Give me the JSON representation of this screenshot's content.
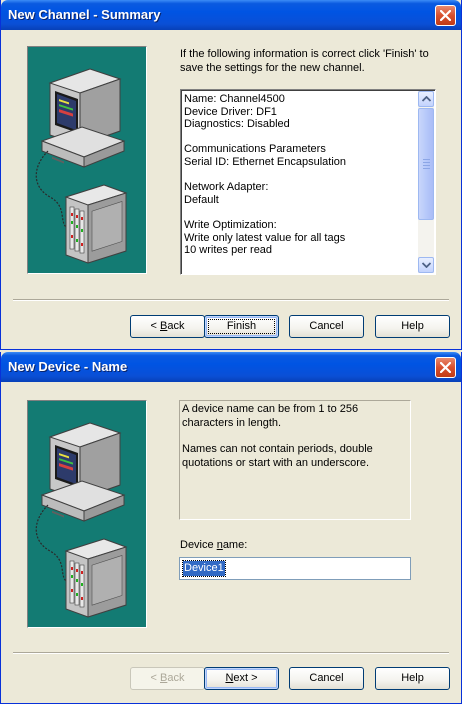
{
  "dialog1": {
    "title": "New Channel - Summary",
    "intro": "If the following information is correct click 'Finish' to save the settings for the new channel.",
    "summary_lines": [
      "Name: Channel4500",
      "Device Driver: DF1",
      "Diagnostics: Disabled",
      "",
      "Communications Parameters",
      "Serial ID: Ethernet Encapsulation",
      "",
      "Network Adapter:",
      "Default",
      "",
      "Write Optimization:",
      "Write only latest value for all tags",
      "10 writes per read"
    ],
    "buttons": {
      "back_prefix": "< ",
      "back_mnemonic": "B",
      "back_rest": "ack",
      "finish": "Finish",
      "cancel": "Cancel",
      "help": "Help"
    }
  },
  "dialog2": {
    "title": "New Device - Name",
    "info_p1": "A device name can be from 1 to 256 characters in length.",
    "info_p2": "Names can not contain periods, double quotations or start with an underscore.",
    "field_label_before": "Device ",
    "field_label_mnemonic": "n",
    "field_label_after": "ame:",
    "device_name_value": "Device1",
    "buttons": {
      "back_prefix": "< ",
      "back_mnemonic": "B",
      "back_rest": "ack",
      "next_prefix": "",
      "next_mnemonic": "N",
      "next_rest": "ext >",
      "cancel": "Cancel",
      "help": "Help"
    },
    "back_disabled": true
  },
  "colors": {
    "titlebar": "#0054e3",
    "art_background": "#137b73",
    "selection": "#316ac5",
    "dialog_face": "#ece9d8"
  },
  "icons": [
    "close-icon",
    "computer-illustration",
    "plc-rack-illustration",
    "scroll-up-icon",
    "scroll-down-icon"
  ]
}
